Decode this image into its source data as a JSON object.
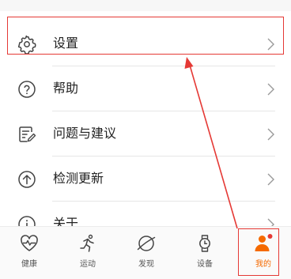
{
  "menu": {
    "items": [
      {
        "label": "设置",
        "icon": "gear-icon"
      },
      {
        "label": "帮助",
        "icon": "question-circle-icon"
      },
      {
        "label": "问题与建议",
        "icon": "edit-note-icon"
      },
      {
        "label": "检测更新",
        "icon": "upload-circle-icon"
      },
      {
        "label": "关于",
        "icon": "info-circle-icon"
      }
    ]
  },
  "bottom_nav": {
    "tabs": [
      {
        "label": "健康",
        "icon": "heart-pulse-icon"
      },
      {
        "label": "运动",
        "icon": "runner-icon"
      },
      {
        "label": "发现",
        "icon": "discover-icon"
      },
      {
        "label": "设备",
        "icon": "watch-icon"
      },
      {
        "label": "我的",
        "icon": "profile-icon",
        "active": true
      }
    ]
  },
  "colors": {
    "accent": "#f56a00",
    "annotation": "#e53935",
    "text": "#222222",
    "icon": "#444444"
  }
}
